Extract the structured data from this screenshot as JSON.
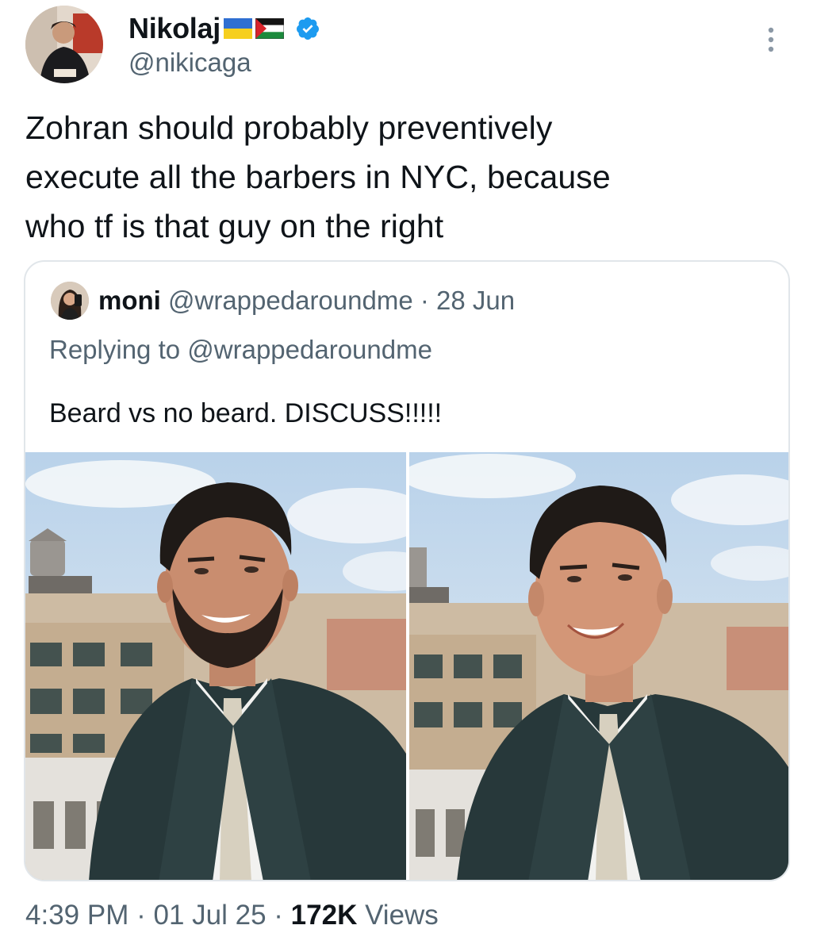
{
  "author": {
    "display_name": "Nikolaj",
    "flags": [
      "ukraine-flag",
      "palestine-flag"
    ],
    "handle": "@nikicaga",
    "verified": true
  },
  "tweet": {
    "lines": [
      "Zohran should probably preventively",
      "execute all the barbers in NYC, because",
      "who tf is that guy on the right"
    ]
  },
  "quote": {
    "display_name": "moni",
    "handle": "@wrappedaroundme",
    "separator": "·",
    "date": "28 Jun",
    "replying_prefix": "Replying to",
    "replying_handle": "@wrappedaroundme",
    "text": "Beard vs no beard. DISCUSS!!!!!",
    "photos": [
      "photo-with-beard",
      "photo-without-beard"
    ]
  },
  "footer": {
    "time": "4:39 PM",
    "sep1": "·",
    "date": "01 Jul 25",
    "sep2": "·",
    "views_count": "172K",
    "views_label": "Views"
  },
  "colors": {
    "text": "#0f1419",
    "secondary": "#536471",
    "verified": "#1d9bf0",
    "border": "#e1e6ea"
  }
}
